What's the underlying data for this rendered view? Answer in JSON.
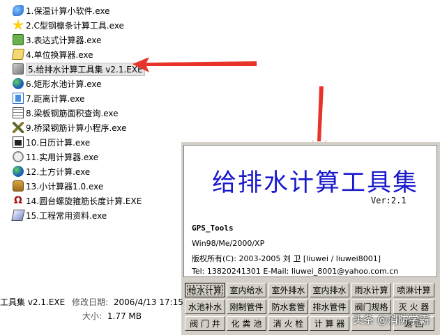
{
  "files": [
    {
      "name": "1.保温计算小软件.exe",
      "icon": "bird-icon"
    },
    {
      "name": "2.C型钢檩条计算工具.exe",
      "icon": "star-icon"
    },
    {
      "name": "3.表达式计算器.exe",
      "icon": "calculator-icon"
    },
    {
      "name": "4.单位换算器.exe",
      "icon": "folder-icon"
    },
    {
      "name": "5.给排水计算工具集 v2.1.EXE",
      "icon": "tool-icon",
      "selected": true
    },
    {
      "name": "6.矩形水池计算.exe",
      "icon": "globe-icon"
    },
    {
      "name": "7.距离计算.exe",
      "icon": "book-icon"
    },
    {
      "name": "8.梁板钢筋面积查询.exe",
      "icon": "grid-icon"
    },
    {
      "name": "9.桥梁钢筋计算小程序.exe",
      "icon": "crossed-tools-icon"
    },
    {
      "name": "10.日历计算.exe",
      "icon": "calendar-icon"
    },
    {
      "name": "11.实用计算器.exe",
      "icon": "ring-icon"
    },
    {
      "name": "12.土方计算.exe",
      "icon": "globe-icon"
    },
    {
      "name": "13.小计算器1.0.exe",
      "icon": "jar-icon"
    },
    {
      "name": "14.圆台螺旋箍筋长度计算.EXE",
      "icon": "omega-icon"
    },
    {
      "name": "15.工程常用资料.exe",
      "icon": "disk-icon"
    }
  ],
  "splash": {
    "title": "给排水计算工具集",
    "version": "Ver:2.1",
    "app_id": "GPS_Tools",
    "platforms": "Win98/Me/2000/XP",
    "copyright": "版权所有(C):  2003-2005  刘 卫 [liuwei / liuwei8001]",
    "contact": "Tel:  13820241301    E-Mail:  liuwei_8001@yahoo.com.cn"
  },
  "buttons": [
    [
      "给水计算",
      "室内给水",
      "室外排水",
      "室内排水",
      "雨水计算",
      "喷淋计算"
    ],
    [
      "水池补水",
      "刚制管件",
      "防水套管",
      "排水管件",
      "阀门规格",
      "灭 火 器"
    ],
    [
      "阀 门 井",
      "化 粪 池",
      "消 火 栓",
      "计 算 器",
      "",
      "返 回"
    ]
  ],
  "details": {
    "name": "工具集 v2.1.EXE",
    "modified_label": "修改日期:",
    "modified_value": "2006/4/13 17:15",
    "size_label": "大小:",
    "size_value": "1.77 MB"
  },
  "watermark": "头条 @消防学霸",
  "colors": {
    "title": "#1a1acc",
    "arrow": "#e8332a",
    "panel": "#d4d0c8"
  }
}
